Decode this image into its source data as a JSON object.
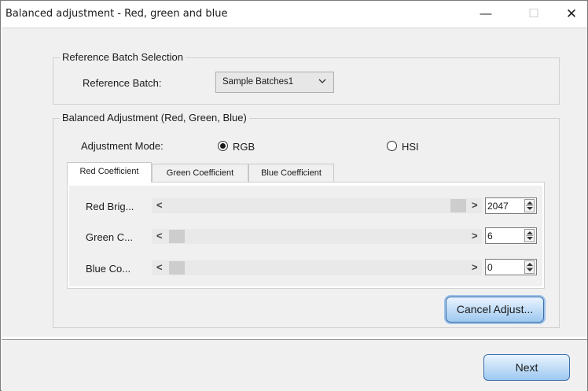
{
  "window": {
    "title": "Balanced adjustment - Red, green and blue",
    "controls": {
      "minimize": "—",
      "maximize": "☐",
      "close": "✕"
    }
  },
  "reference_batch_group": {
    "legend": "Reference Batch Selection",
    "label": "Reference Batch:",
    "selected": "Sample Batches1"
  },
  "balanced_group": {
    "legend": "Balanced Adjustment (Red, Green, Blue)",
    "mode_label": "Adjustment Mode:",
    "modes": [
      {
        "label": "RGB",
        "selected": true
      },
      {
        "label": "HSI",
        "selected": false
      }
    ],
    "tabs": [
      {
        "label": "Red Coefficient",
        "active": true
      },
      {
        "label": "Green Coefficient",
        "active": false
      },
      {
        "label": "Blue Coefficient",
        "active": false
      }
    ],
    "sliders": [
      {
        "label": "Red Brig...",
        "value": "2047",
        "level": 1.0
      },
      {
        "label": "Green C...",
        "value": "6",
        "level": 0.0
      },
      {
        "label": "Blue Co...",
        "value": "0",
        "level": 0.0
      }
    ],
    "cancel_button": "Cancel Adjust..."
  },
  "footer": {
    "next_button": "Next"
  },
  "icons": {
    "scroll_left": "<",
    "scroll_right": ">",
    "dropdown": "chevron-down-icon"
  }
}
